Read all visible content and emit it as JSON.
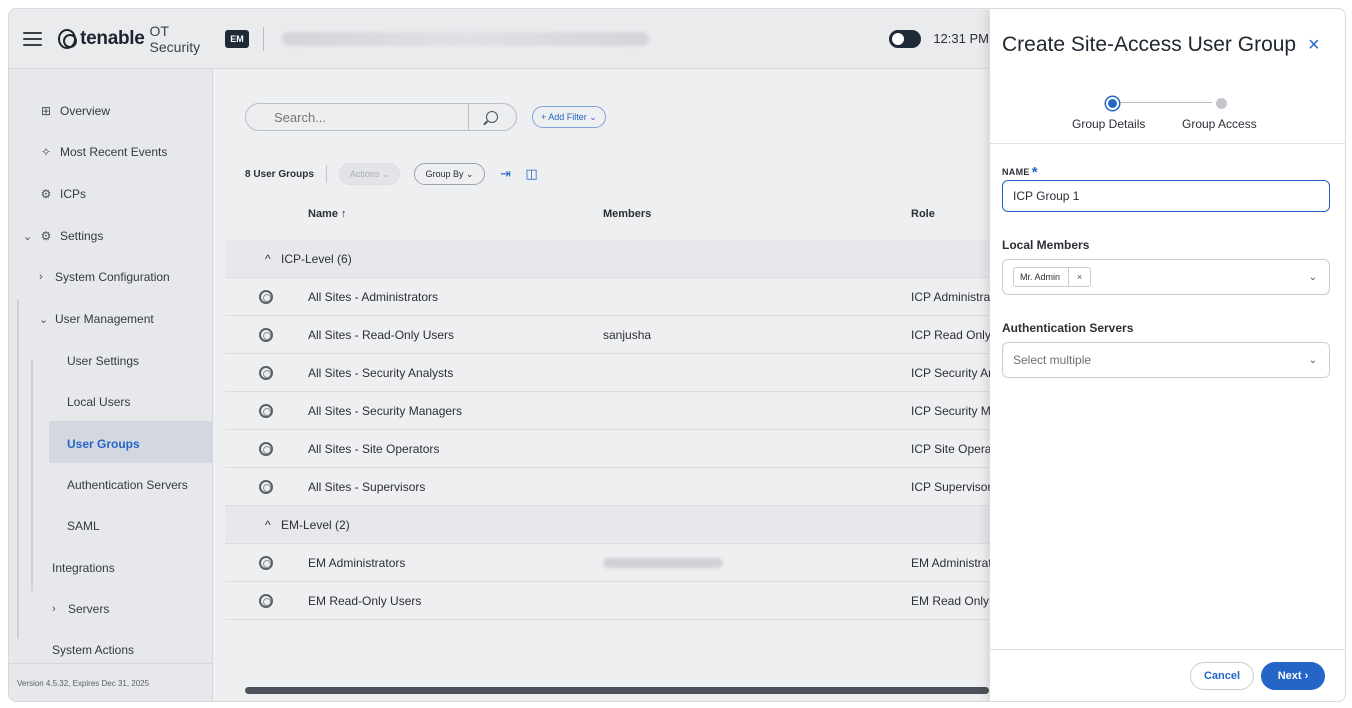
{
  "header": {
    "brand_name": "tenable",
    "brand_product": "OT Security",
    "env_badge": "EM",
    "time": "12:31 PM"
  },
  "sidebar": {
    "items": [
      {
        "label": "Overview",
        "icon": "grid-icon"
      },
      {
        "label": "Most Recent Events",
        "icon": "events-icon"
      },
      {
        "label": "ICPs",
        "icon": "icp-icon"
      },
      {
        "label": "Settings",
        "icon": "gear-icon"
      },
      {
        "label": "System Configuration"
      },
      {
        "label": "User Management"
      },
      {
        "label": "User Settings"
      },
      {
        "label": "Local Users"
      },
      {
        "label": "User Groups"
      },
      {
        "label": "Authentication Servers"
      },
      {
        "label": "SAML"
      },
      {
        "label": "Integrations"
      },
      {
        "label": "Servers"
      },
      {
        "label": "System Actions"
      }
    ],
    "active_item": "User Groups",
    "version": "Version 4.5.32, Expires Dec 31, 2025"
  },
  "main": {
    "search_placeholder": "Search...",
    "add_filter": "+ Add Filter ⌄",
    "count": "8 User Groups",
    "actions_label": "Actions ⌄",
    "group_by_label": "Group By ⌄",
    "columns": [
      "Name ↑",
      "Members",
      "Role"
    ],
    "groups": [
      {
        "label": "ICP-Level (6)",
        "rows": [
          {
            "name": "All Sites - Administrators",
            "members": "",
            "role": "ICP Administrat"
          },
          {
            "name": "All Sites - Read-Only Users",
            "members": "sanjusha",
            "role": "ICP Read Only"
          },
          {
            "name": "All Sites - Security Analysts",
            "members": "",
            "role": "ICP Security An"
          },
          {
            "name": "All Sites - Security Managers",
            "members": "",
            "role": "ICP Security Ma"
          },
          {
            "name": "All Sites - Site Operators",
            "members": "",
            "role": "ICP Site Operat"
          },
          {
            "name": "All Sites - Supervisors",
            "members": "",
            "role": "ICP Supervisor"
          }
        ]
      },
      {
        "label": "EM-Level (2)",
        "rows": [
          {
            "name": "EM Administrators",
            "members": "",
            "role": "EM Administrato"
          },
          {
            "name": "EM Read-Only Users",
            "members": "",
            "role": "EM Read Only"
          }
        ]
      }
    ]
  },
  "panel": {
    "title": "Create Site-Access User Group",
    "close": "×",
    "steps": [
      "Group Details",
      "Group Access"
    ],
    "active_step": 0,
    "name_label": "NAME",
    "required_mark": "*",
    "name_value": "ICP Group 1",
    "local_members_label": "Local Members",
    "local_members_chip": "Mr. Admin",
    "chip_remove": "×",
    "auth_servers_label": "Authentication Servers",
    "auth_servers_placeholder": "Select multiple",
    "cancel": "Cancel",
    "next": "Next ›"
  },
  "colors": {
    "accent": "#2565c7",
    "header_bg": "#eaebed",
    "sidebar_bg": "#e7e8eb",
    "panel_bg": "#ffffff"
  }
}
